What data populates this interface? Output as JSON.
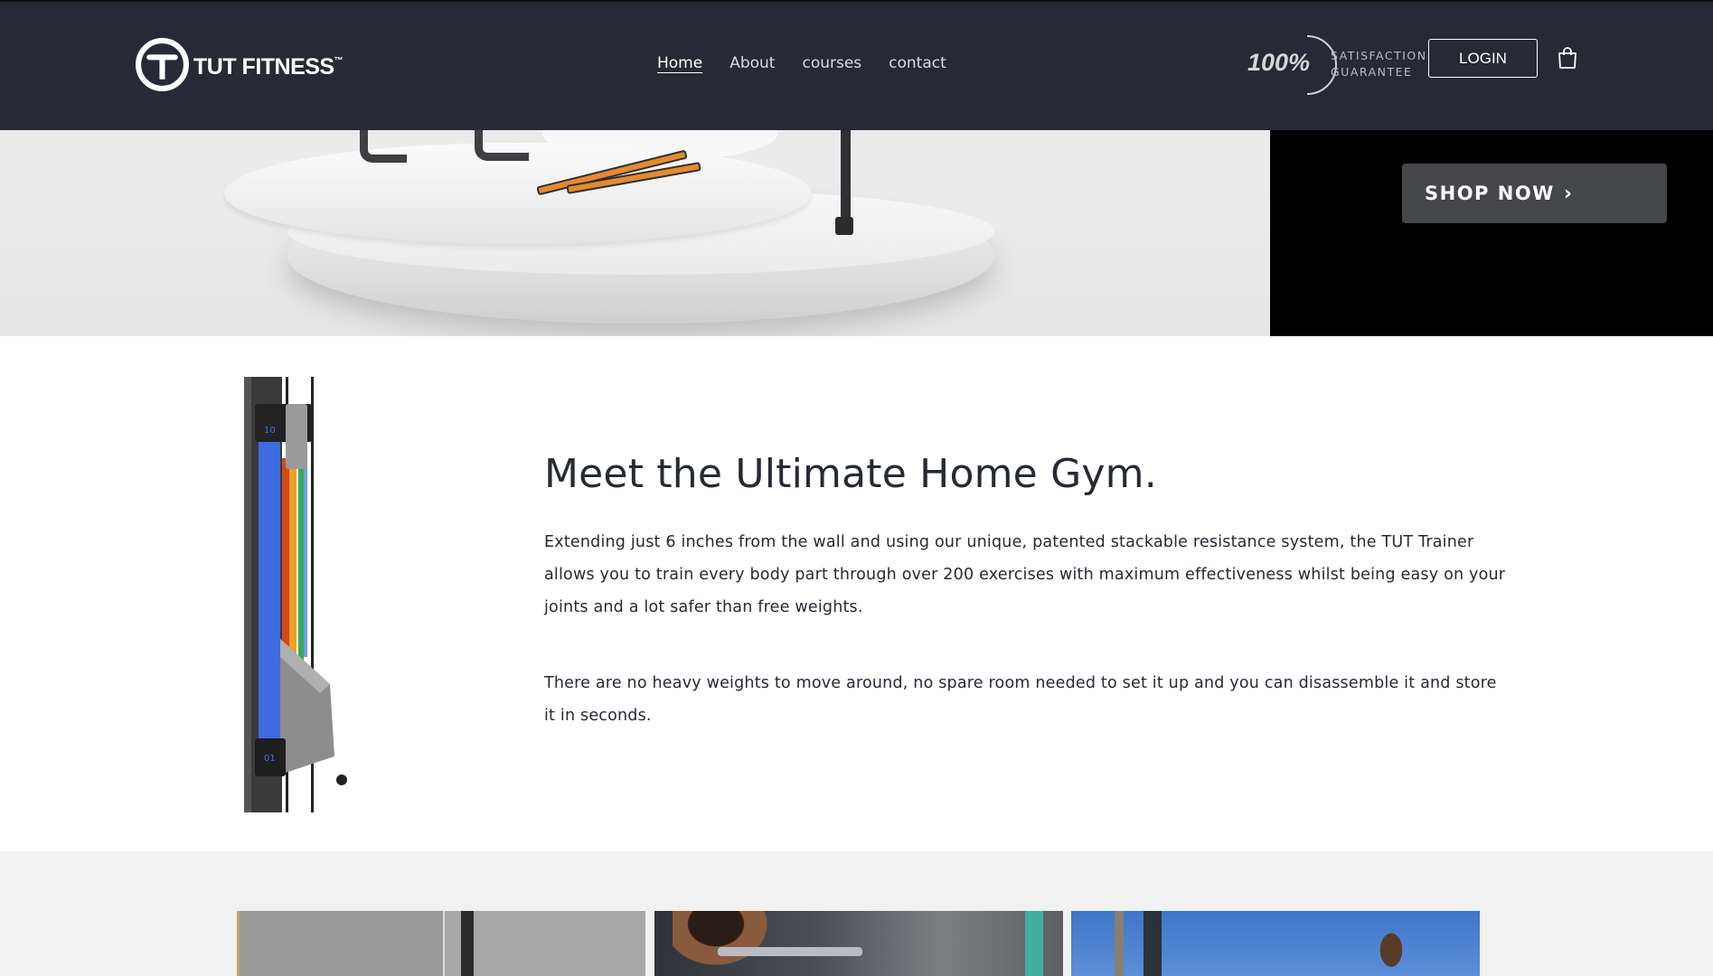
{
  "header": {
    "logo_text": "TUT FITNESS",
    "logo_tm": "™",
    "nav": [
      {
        "label": "Home",
        "active": true
      },
      {
        "label": "About",
        "active": false
      },
      {
        "label": "courses",
        "active": false
      },
      {
        "label": "contact",
        "active": false
      }
    ],
    "guarantee": {
      "percent": "100%",
      "line1": "SATISFACTION",
      "line2": "GUARANTEE"
    },
    "login_label": "LOGIN",
    "cart_icon": "cart-icon"
  },
  "hero": {
    "shop_label": "SHOP NOW",
    "shop_icon": "chevron-right-icon"
  },
  "about": {
    "title": "Meet the Ultimate Home Gym.",
    "paragraph1": "Extending just 6 inches from the wall and using our unique, patented stackable resistance system, the TUT Trainer allows you to train every body part through over 200 exercises with maximum effectiveness whilst being easy on your joints and a lot safer than free weights.",
    "paragraph2": "There are no heavy weights to move around, no spare room needed to set it up and you can disassemble it and store it in seconds."
  },
  "colors": {
    "header_bg": "#262a36",
    "hero_side_bg": "#000000",
    "shop_button_bg": "#46474b",
    "gallery_bg": "#f1f1f1"
  }
}
